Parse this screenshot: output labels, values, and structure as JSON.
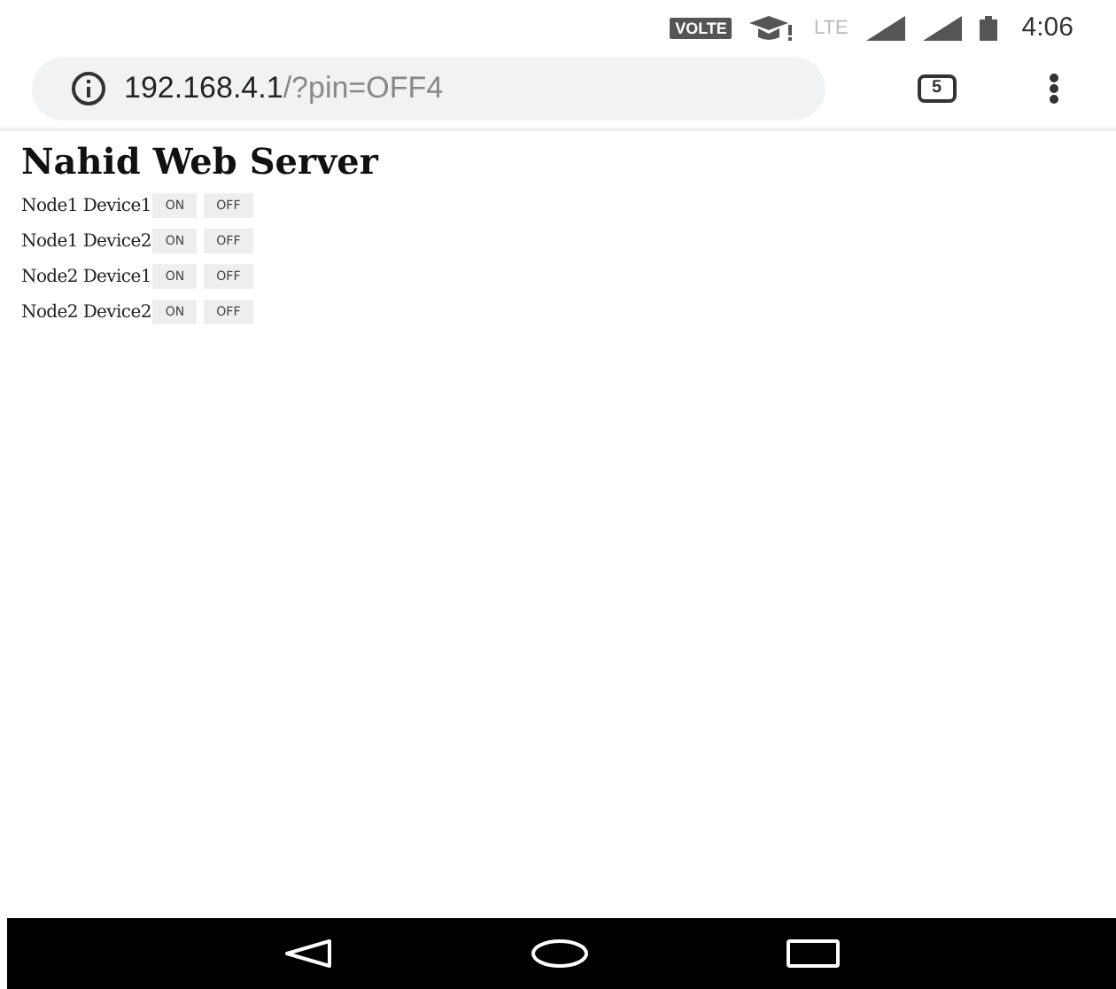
{
  "status_bar": {
    "volte": "VOLTE",
    "network": "LTE",
    "time": "4:06"
  },
  "address_bar": {
    "host": "192.168.4.1",
    "path": "/?pin=OFF4",
    "tab_count": "5"
  },
  "page": {
    "title": "Nahid Web Server",
    "devices": [
      {
        "label": "Node1 Device1",
        "buttons": [
          "ON",
          "OFF"
        ]
      },
      {
        "label": "Node1 Device2",
        "buttons": [
          "ON",
          "OFF"
        ]
      },
      {
        "label": "Node2 Device1",
        "buttons": [
          "ON",
          "OFF"
        ]
      },
      {
        "label": "Node2 Device2",
        "buttons": [
          "ON",
          "OFF"
        ]
      }
    ]
  }
}
